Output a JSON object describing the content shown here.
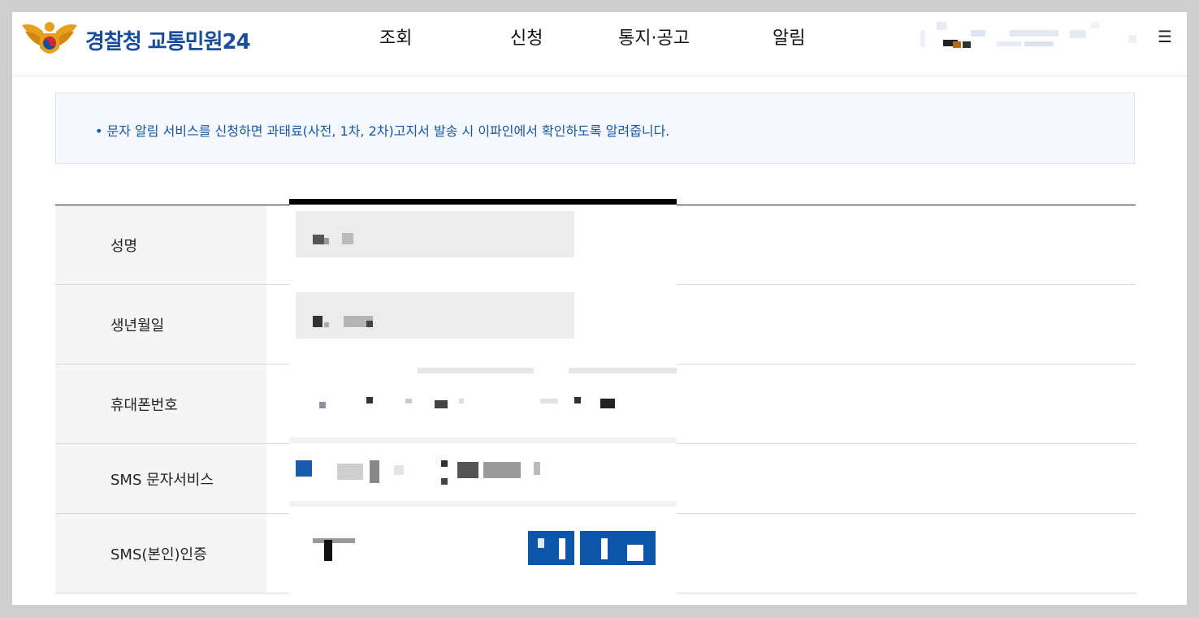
{
  "header": {
    "logo_text": "경찰청 교통민원24",
    "nav": [
      "조회",
      "신청",
      "통지·공고",
      "알림"
    ],
    "menu_icon": "hamburger-menu-icon"
  },
  "notice": {
    "text": "• 문자 알림 서비스를 신청하면 과태료(사전, 1차, 2차)고지서 발송 시 이파인에서 확인하도록 알려줍니다."
  },
  "form": {
    "labels": [
      "성명",
      "생년월일",
      "휴대폰번호",
      "SMS 문자서비스",
      "SMS(본인)인증"
    ]
  },
  "colors": {
    "brand": "#1a4c9c",
    "notice_text": "#1657a8",
    "button": "#0c55a8"
  }
}
